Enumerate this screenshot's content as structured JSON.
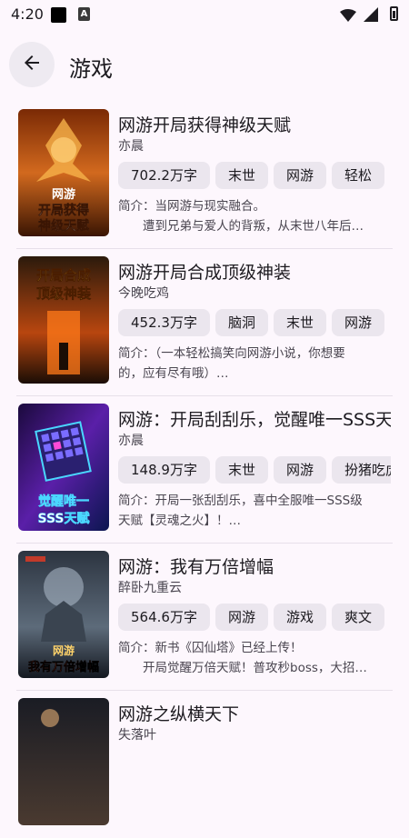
{
  "status": {
    "time": "4:20",
    "a_icon": "A"
  },
  "header": {
    "title": "游戏"
  },
  "books": [
    {
      "title": "网游开局获得神级天赋",
      "author": "亦晨",
      "tags": [
        "702.2万字",
        "末世",
        "网游",
        "轻松"
      ],
      "desc1": "简介：当网游与现实融合。",
      "desc2": "　　遭到兄弟与爱人的背叛，从末世八年后…",
      "cover_text": "网游 开局获得 神级天赋"
    },
    {
      "title": "网游开局合成顶级神装",
      "author": "今晚吃鸡",
      "tags": [
        "452.3万字",
        "脑洞",
        "末世",
        "网游"
      ],
      "desc1": "简介：（一本轻松搞笑向网游小说，你想要",
      "desc2": "的，应有尽有哦）…",
      "cover_text": "开局合成 顶级神装"
    },
    {
      "title": "网游：开局刮刮乐，觉醒唯一SSS天赋",
      "author": "亦晨",
      "tags": [
        "148.9万字",
        "末世",
        "网游",
        "扮猪吃虎"
      ],
      "desc1": "简介：开局一张刮刮乐，喜中全服唯一SSS级",
      "desc2": "天赋【灵魂之火】！…",
      "cover_text": "觉醒唯一 SSS天赋"
    },
    {
      "title": "网游：我有万倍增幅",
      "author": "醉卧九重云",
      "tags": [
        "564.6万字",
        "网游",
        "游戏",
        "爽文"
      ],
      "desc1": "简介：新书《囚仙塔》已经上传！",
      "desc2": "　　开局觉醒万倍天赋！普攻秒boss，大招…",
      "cover_text": "网游 我有万倍增幅"
    },
    {
      "title": "网游之纵横天下",
      "author": "失落叶",
      "tags": [],
      "desc1": "",
      "desc2": "",
      "cover_text": ""
    }
  ]
}
